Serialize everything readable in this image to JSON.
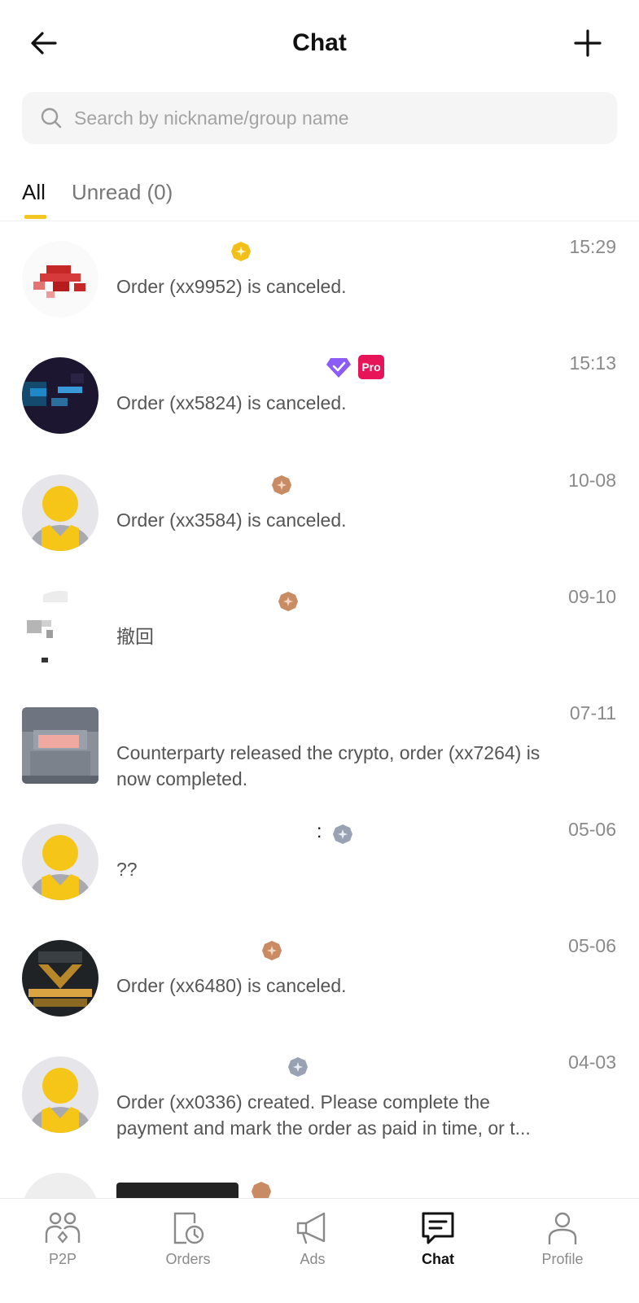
{
  "header": {
    "title": "Chat",
    "back_icon": "arrow-left-icon",
    "add_icon": "plus-icon"
  },
  "search": {
    "placeholder": "Search by nickname/group name",
    "value": ""
  },
  "tabs": [
    {
      "label": "All",
      "active": true
    },
    {
      "label": "Unread (0)",
      "active": false
    }
  ],
  "chats": [
    {
      "time": "15:29",
      "message": "Order (xx9952) is canceled.",
      "badges": [
        "gold-badge-icon"
      ],
      "avatar": "pixelated-red-avatar"
    },
    {
      "time": "15:13",
      "message": "Order (xx5824) is canceled.",
      "badges": [
        "verified-diamond-icon",
        "pro-badge-icon"
      ],
      "pro_label": "Pro",
      "avatar": "pixelated-dark-avatar"
    },
    {
      "time": "10-08",
      "message": "Order (xx3584) is canceled.",
      "badges": [
        "bronze-badge-icon"
      ],
      "avatar": "default-avatar"
    },
    {
      "time": "09-10",
      "message": "撤回",
      "badges": [
        "bronze-badge-icon"
      ],
      "avatar": "pixelated-light-avatar"
    },
    {
      "time": "07-11",
      "message": "Counterparty released the crypto, order (xx7264) is now completed.",
      "badges": [],
      "avatar": "pixelated-grey-avatar"
    },
    {
      "time": "05-06",
      "message": "??",
      "badges": [
        "silver-badge-icon"
      ],
      "name_fragment": ":",
      "avatar": "default-avatar"
    },
    {
      "time": "05-06",
      "message": "Order (xx6480) is canceled.",
      "badges": [
        "bronze-badge-icon"
      ],
      "avatar": "pixelated-black-gold-avatar"
    },
    {
      "time": "04-03",
      "message": "Order (xx0336) created. Please complete the payment and mark the order as paid in time, or t...",
      "badges": [
        "silver-badge-icon"
      ],
      "avatar": "default-avatar"
    }
  ],
  "tabbar": [
    {
      "label": "P2P",
      "icon": "p2p-users-icon",
      "active": false
    },
    {
      "label": "Orders",
      "icon": "orders-clock-icon",
      "active": false
    },
    {
      "label": "Ads",
      "icon": "megaphone-icon",
      "active": false
    },
    {
      "label": "Chat",
      "icon": "chat-bubble-icon",
      "active": true
    },
    {
      "label": "Profile",
      "icon": "profile-person-icon",
      "active": false
    }
  ],
  "colors": {
    "accent": "#f3c623",
    "muted_text": "#8a8a8a",
    "search_bg": "#f5f5f5",
    "pro_badge": "#e8145a",
    "verified": "#8b5cf6"
  }
}
